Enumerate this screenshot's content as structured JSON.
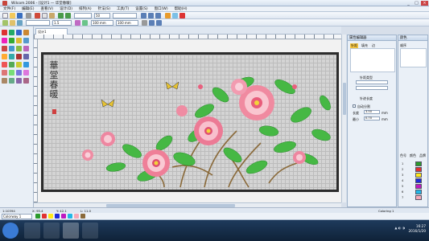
{
  "window": {
    "title": "Wilcom 2006 - [设计1 — 华堂春暖]",
    "buttons": [
      "_",
      "□",
      "×"
    ]
  },
  "menu": [
    "文件(F)",
    "编辑(E)",
    "查看(V)",
    "设计(D)",
    "排列(A)",
    "针法(S)",
    "工具(T)",
    "设置(S)",
    "窗口(W)",
    "帮助(H)"
  ],
  "toolbar2": {
    "combo1": "",
    "combo2": "50",
    "combo3": ""
  },
  "toolbar3": {
    "combo1": "",
    "combo2": "1.5",
    "combo3": "100 mm",
    "combo4": "100 mm"
  },
  "tab": {
    "label": "设计1"
  },
  "design": {
    "calligraphy": "華堂春暖"
  },
  "stitchpanel": {
    "title": "属性编辑器",
    "tabs": [
      "针距",
      "填充",
      "边"
    ],
    "section1": "针距类型",
    "section2": "针迹长度",
    "option": "自动分割",
    "length_label": "长度",
    "length": "3.50",
    "unit": "mm",
    "min_label": "最小",
    "min": "0.70"
  },
  "colorpanel": {
    "title": "颜色",
    "sequence_title": "顺序",
    "tabs": [
      "色号",
      "颜色",
      "品牌"
    ],
    "items": [
      {
        "num": "1",
        "color": "#2b9a2b"
      },
      {
        "num": "2",
        "color": "#e03030"
      },
      {
        "num": "3",
        "color": "#ffe818"
      },
      {
        "num": "4",
        "color": "#1e2ad8"
      },
      {
        "num": "5",
        "color": "#c018c0"
      },
      {
        "num": "6",
        "color": "#22b7e6"
      },
      {
        "num": "7",
        "color": "#f6a8b8"
      }
    ]
  },
  "statusbar": {
    "left": "1:10394",
    "mid1": "X: 95.4",
    "mid2": "Y: 42.1",
    "mid3": "L: 11.0",
    "right": "Coloring 1"
  },
  "bottombar": {
    "dropdown": "Colorway 1"
  },
  "taskbar": {
    "time": "16:27",
    "date": "2016/1/20"
  }
}
